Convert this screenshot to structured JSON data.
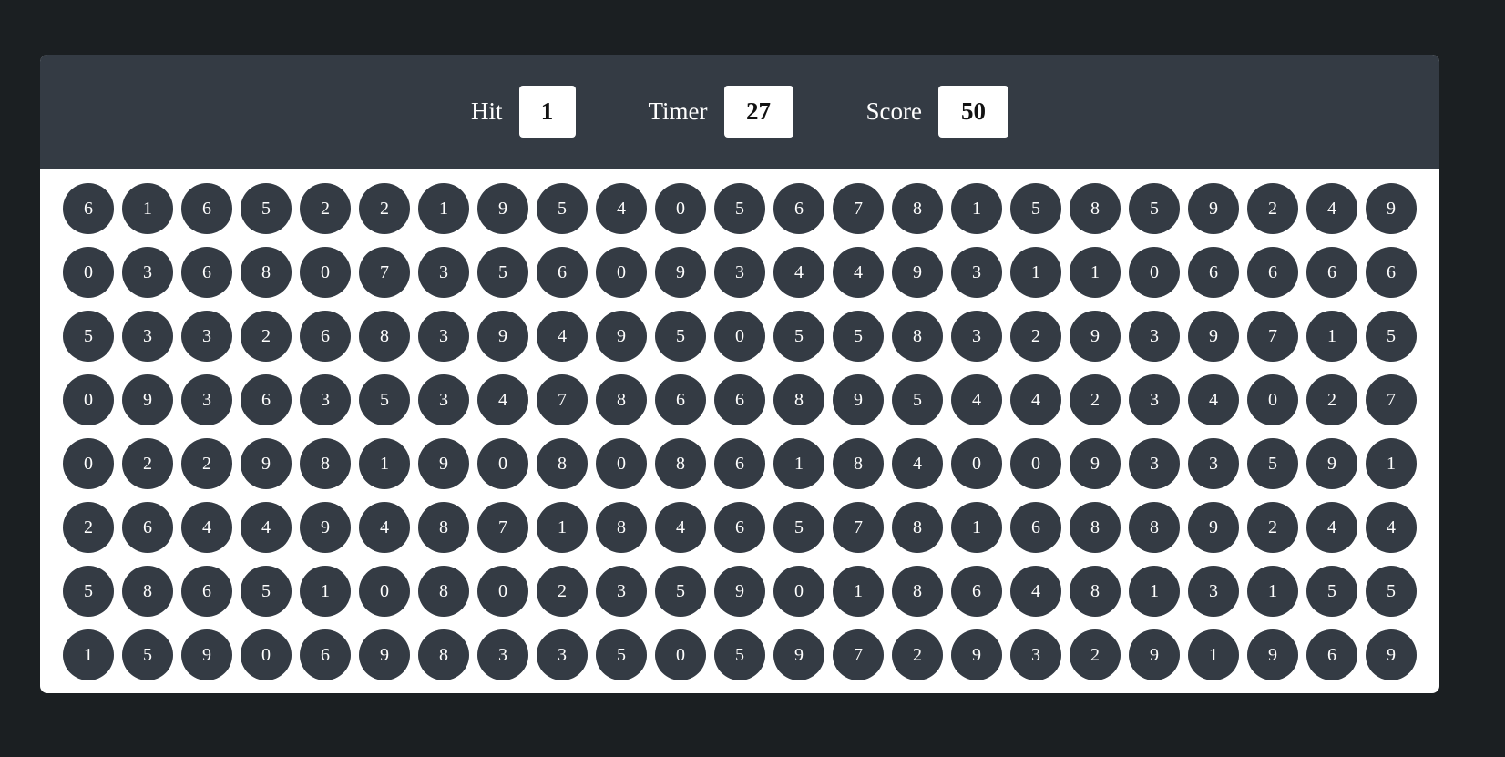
{
  "stats": {
    "hit": {
      "label": "Hit",
      "value": "1"
    },
    "timer": {
      "label": "Timer",
      "value": "27"
    },
    "score": {
      "label": "Score",
      "value": "50"
    }
  },
  "bubbles": [
    [
      "6",
      "1",
      "6",
      "5",
      "2",
      "2",
      "1",
      "9",
      "5",
      "4",
      "0",
      "5",
      "6",
      "7",
      "8",
      "1",
      "5",
      "8",
      "5",
      "9",
      "2",
      "4",
      "9"
    ],
    [
      "0",
      "3",
      "6",
      "8",
      "0",
      "7",
      "3",
      "5",
      "6",
      "0",
      "9",
      "3",
      "4",
      "4",
      "9",
      "3",
      "1",
      "1",
      "0",
      "6",
      "6",
      "6",
      "6"
    ],
    [
      "5",
      "3",
      "3",
      "2",
      "6",
      "8",
      "3",
      "9",
      "4",
      "9",
      "5",
      "0",
      "5",
      "5",
      "8",
      "3",
      "2",
      "9",
      "3",
      "9",
      "7",
      "1",
      "5"
    ],
    [
      "0",
      "9",
      "3",
      "6",
      "3",
      "5",
      "3",
      "4",
      "7",
      "8",
      "6",
      "6",
      "8",
      "9",
      "5",
      "4",
      "4",
      "2",
      "3",
      "4",
      "0",
      "2",
      "7"
    ],
    [
      "0",
      "2",
      "2",
      "9",
      "8",
      "1",
      "9",
      "0",
      "8",
      "0",
      "8",
      "6",
      "1",
      "8",
      "4",
      "0",
      "0",
      "9",
      "3",
      "3",
      "5",
      "9",
      "1"
    ],
    [
      "2",
      "6",
      "4",
      "4",
      "9",
      "4",
      "8",
      "7",
      "1",
      "8",
      "4",
      "6",
      "5",
      "7",
      "8",
      "1",
      "6",
      "8",
      "8",
      "9",
      "2",
      "4",
      "4"
    ],
    [
      "5",
      "8",
      "6",
      "5",
      "1",
      "0",
      "8",
      "0",
      "2",
      "3",
      "5",
      "9",
      "0",
      "1",
      "8",
      "6",
      "4",
      "8",
      "1",
      "3",
      "1",
      "5",
      "5"
    ],
    [
      "1",
      "5",
      "9",
      "0",
      "6",
      "9",
      "8",
      "3",
      "3",
      "5",
      "0",
      "5",
      "9",
      "7",
      "2",
      "9",
      "3",
      "2",
      "9",
      "1",
      "9",
      "6",
      "9"
    ]
  ],
  "colors": {
    "page_background": "#1b1f22",
    "panel": "#343b44",
    "bubble": "#343b44",
    "bubble_text": "#ffffff",
    "board": "#ffffff"
  }
}
